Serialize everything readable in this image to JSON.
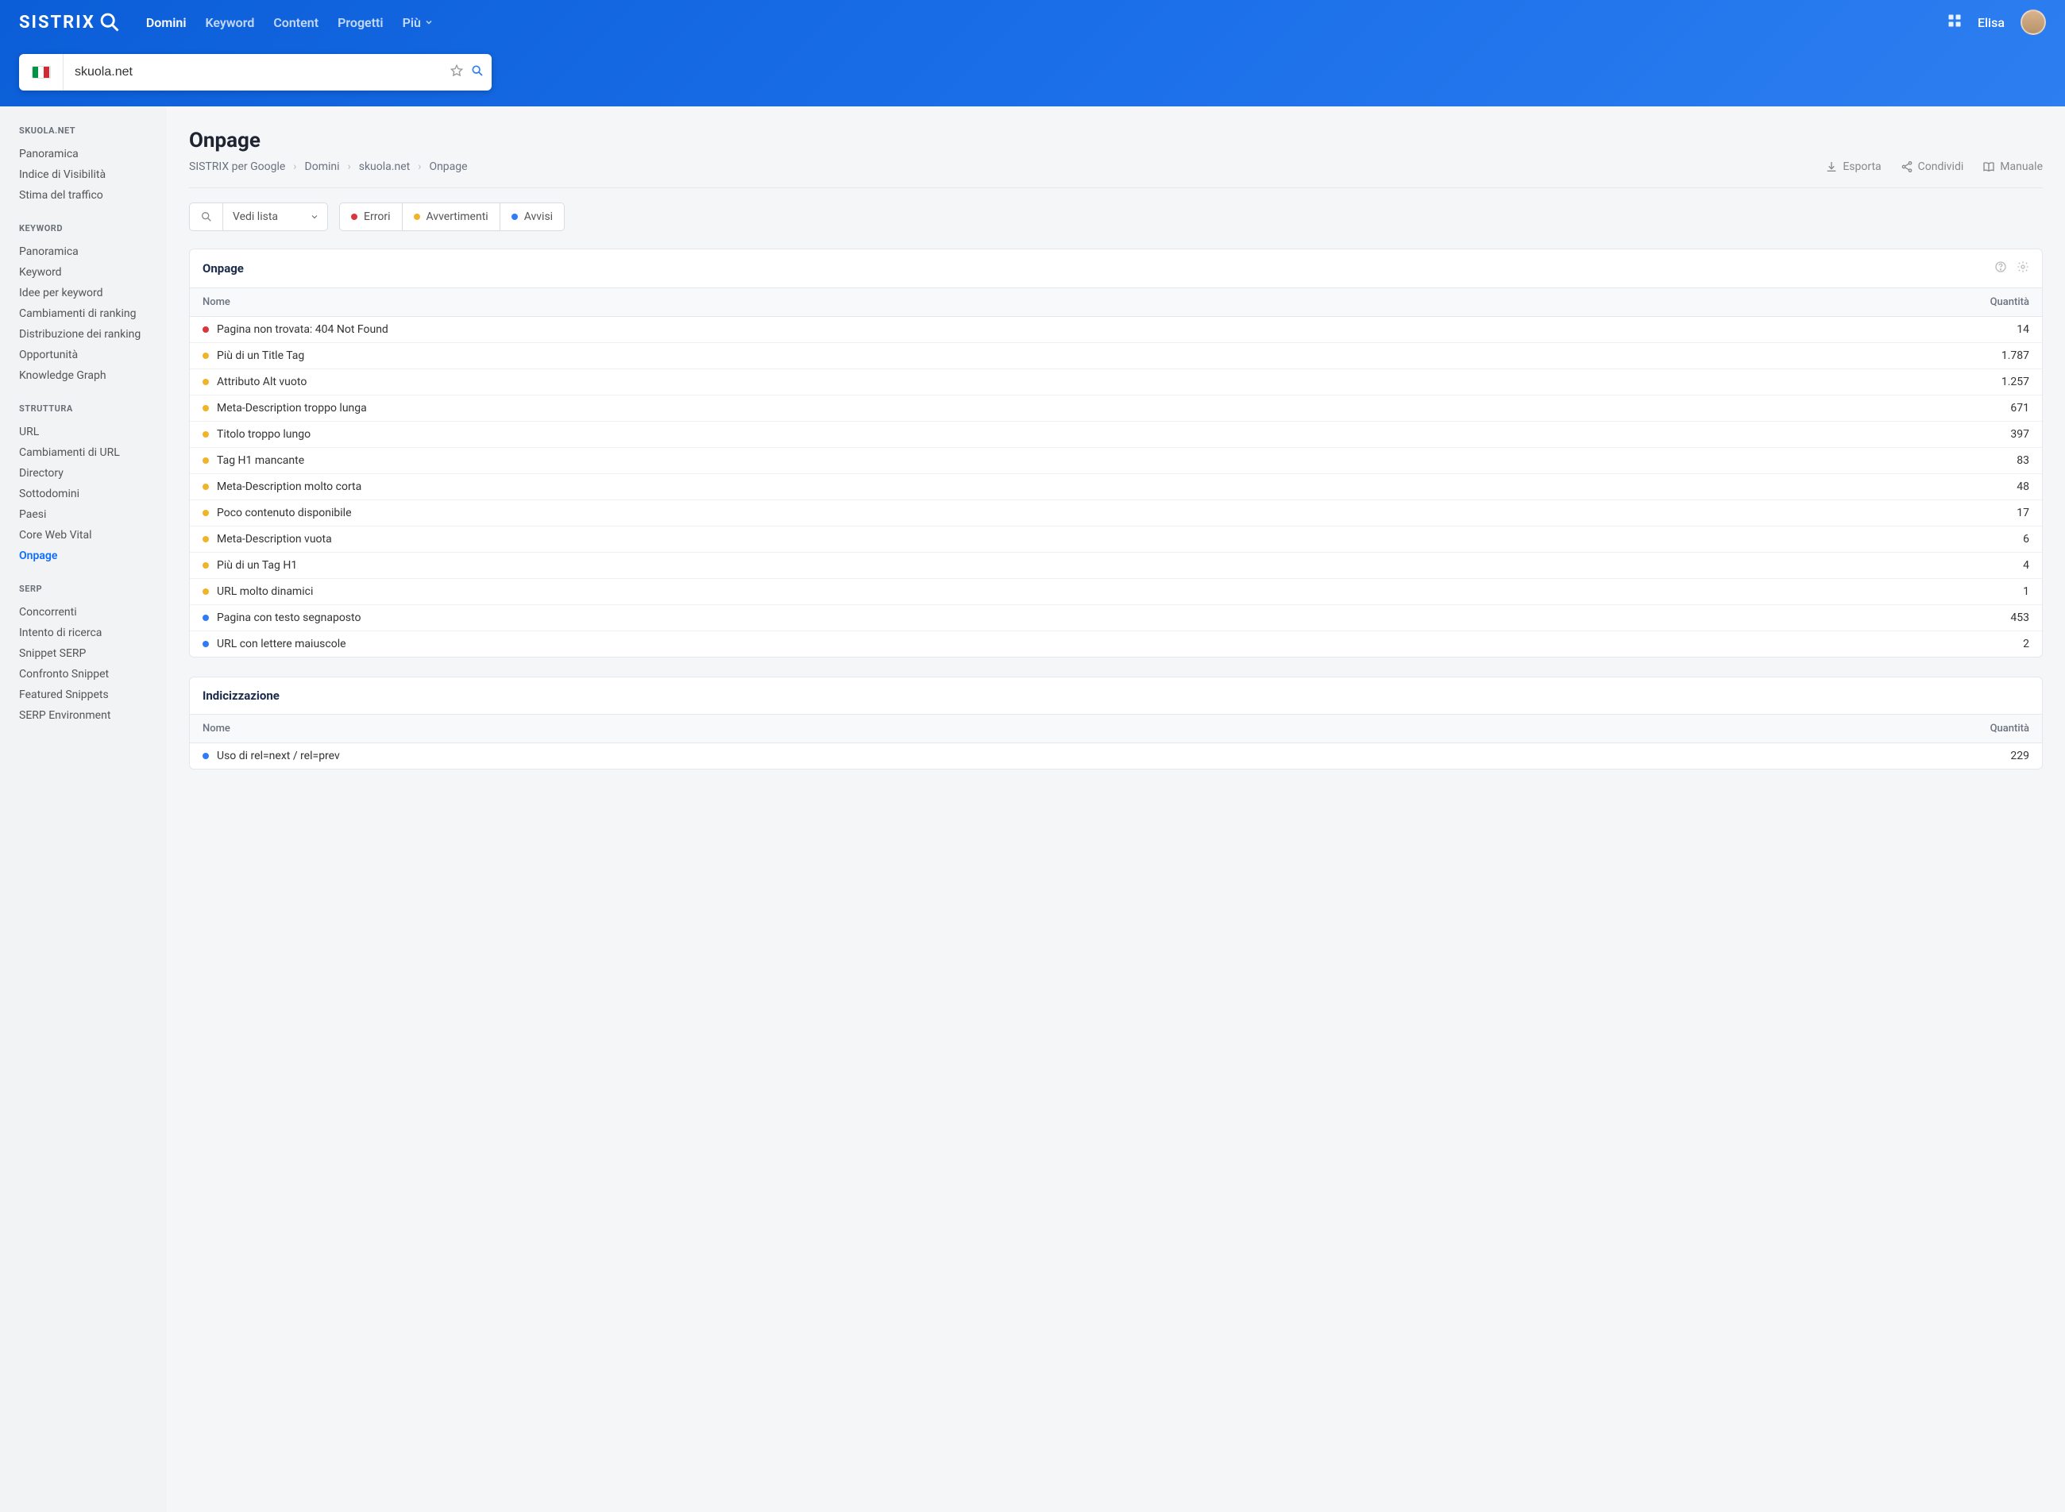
{
  "brand": "SISTRIX",
  "nav": {
    "items": [
      "Domini",
      "Keyword",
      "Content",
      "Progetti"
    ],
    "more": "Più",
    "active": 0
  },
  "user": {
    "name": "Elisa"
  },
  "search": {
    "value": "skuola.net"
  },
  "sidebar": {
    "domain_title": "SKUOLA.NET",
    "domain_items": [
      "Panoramica",
      "Indice di Visibilità",
      "Stima del traffico"
    ],
    "keyword_title": "KEYWORD",
    "keyword_items": [
      "Panoramica",
      "Keyword",
      "Idee per keyword",
      "Cambiamenti di ranking",
      "Distribuzione dei ranking",
      "Opportunità",
      "Knowledge Graph"
    ],
    "struttura_title": "STRUTTURA",
    "struttura_items": [
      "URL",
      "Cambiamenti di URL",
      "Directory",
      "Sottodomini",
      "Paesi",
      "Core Web Vital",
      "Onpage"
    ],
    "struttura_active": 6,
    "serp_title": "SERP",
    "serp_items": [
      "Concorrenti",
      "Intento di ricerca",
      "Snippet SERP",
      "Confronto Snippet",
      "Featured Snippets",
      "SERP Environment"
    ]
  },
  "page": {
    "title": "Onpage",
    "breadcrumb": [
      "SISTRIX per Google",
      "Domini",
      "skuola.net",
      "Onpage"
    ],
    "actions": {
      "export": "Esporta",
      "share": "Condividi",
      "manual": "Manuale"
    },
    "vedi_lista": "Vedi lista",
    "legend": {
      "errori": "Errori",
      "avvertimenti": "Avvertimenti",
      "avvisi": "Avvisi"
    }
  },
  "panels": {
    "onpage": {
      "title": "Onpage",
      "col_name": "Nome",
      "col_qty": "Quantità",
      "rows": [
        {
          "type": "error",
          "name": "Pagina non trovata: 404 Not Found",
          "qty": "14"
        },
        {
          "type": "warn",
          "name": "Più di un Title Tag",
          "qty": "1.787"
        },
        {
          "type": "warn",
          "name": "Attributo Alt vuoto",
          "qty": "1.257"
        },
        {
          "type": "warn",
          "name": "Meta-Description troppo lunga",
          "qty": "671"
        },
        {
          "type": "warn",
          "name": "Titolo troppo lungo",
          "qty": "397"
        },
        {
          "type": "warn",
          "name": "Tag H1 mancante",
          "qty": "83"
        },
        {
          "type": "warn",
          "name": "Meta-Description molto corta",
          "qty": "48"
        },
        {
          "type": "warn",
          "name": "Poco contenuto disponibile",
          "qty": "17"
        },
        {
          "type": "warn",
          "name": "Meta-Description vuota",
          "qty": "6"
        },
        {
          "type": "warn",
          "name": "Più di un Tag H1",
          "qty": "4"
        },
        {
          "type": "warn",
          "name": "URL molto dinamici",
          "qty": "1"
        },
        {
          "type": "info",
          "name": "Pagina con testo segnaposto",
          "qty": "453"
        },
        {
          "type": "info",
          "name": "URL con lettere maiuscole",
          "qty": "2"
        }
      ]
    },
    "indicizzazione": {
      "title": "Indicizzazione",
      "col_name": "Nome",
      "col_qty": "Quantità",
      "rows": [
        {
          "type": "info",
          "name": "Uso di rel=next / rel=prev",
          "qty": "229"
        }
      ]
    }
  }
}
